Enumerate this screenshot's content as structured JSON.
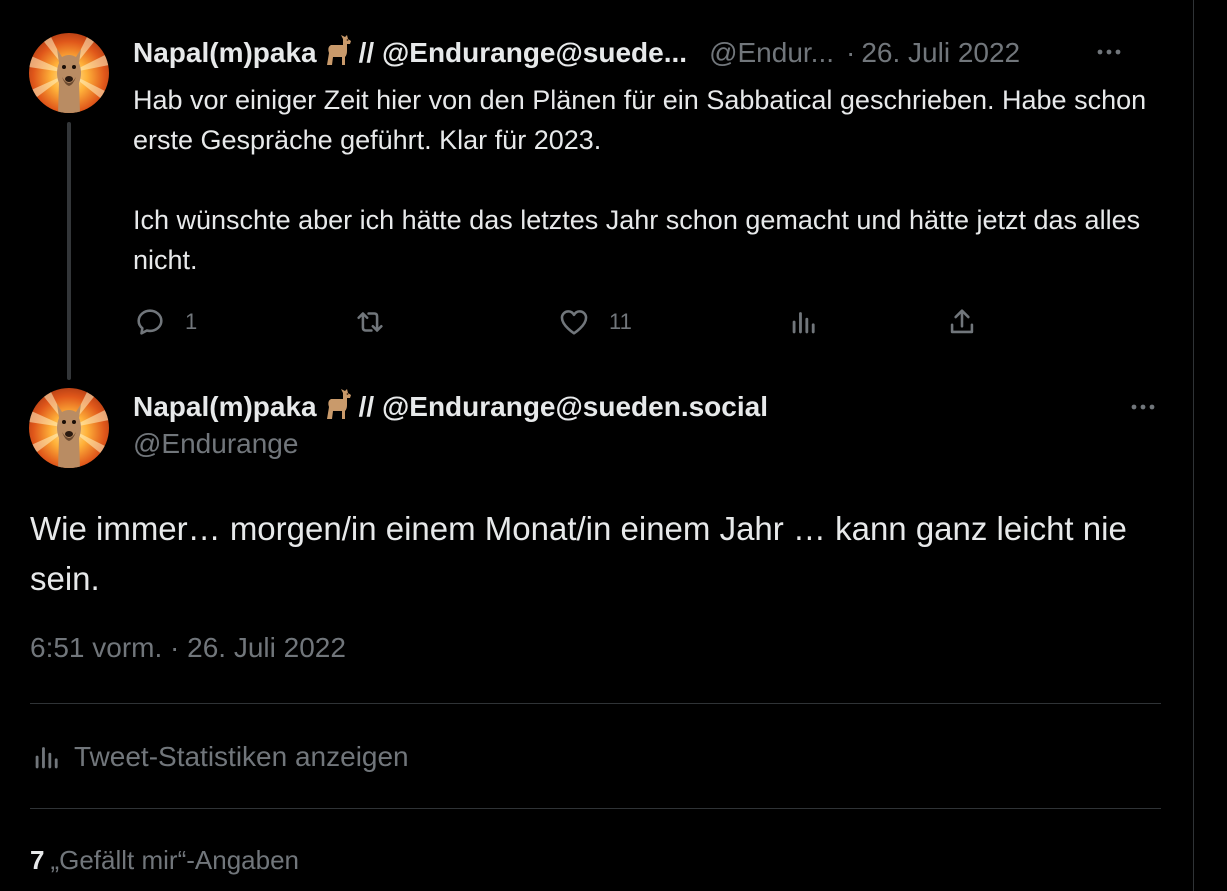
{
  "parent_tweet": {
    "display_name": "Napal(m)paka",
    "name_suffix": "// @Endurange@suede...",
    "handle": "@Endur...",
    "date": "26. Juli 2022",
    "more": "···",
    "text_paragraphs": [
      "Hab vor einiger Zeit hier von den Plänen für ein Sabbatical geschrieben. Habe schon erste Gespräche geführt. Klar für 2023.",
      "Ich wünschte aber ich hätte das letztes Jahr schon gemacht und hätte jetzt das alles nicht."
    ],
    "reply_count": "1",
    "like_count": "11"
  },
  "main_tweet": {
    "display_name": "Napal(m)paka",
    "name_suffix": "// @Endurange@sueden.social",
    "handle": "@Endurange",
    "more": "···",
    "text": "Wie immer… morgen/in einem Monat/in einem Jahr … kann ganz leicht nie sein.",
    "timestamp": "6:51 vorm. · 26. Juli 2022",
    "stats_link": "Tweet-Statistiken anzeigen",
    "likes_count": "7",
    "likes_label": "„Gefällt mir“-Angaben"
  },
  "icons": {
    "reply": "reply-icon",
    "retweet": "retweet-icon",
    "like": "heart-icon",
    "views": "analytics-icon",
    "share": "share-icon",
    "emoji": "llama-emoji"
  },
  "colors": {
    "background": "#000000",
    "text": "#e7e9ea",
    "muted": "#71767b",
    "divider": "#2f3336"
  }
}
